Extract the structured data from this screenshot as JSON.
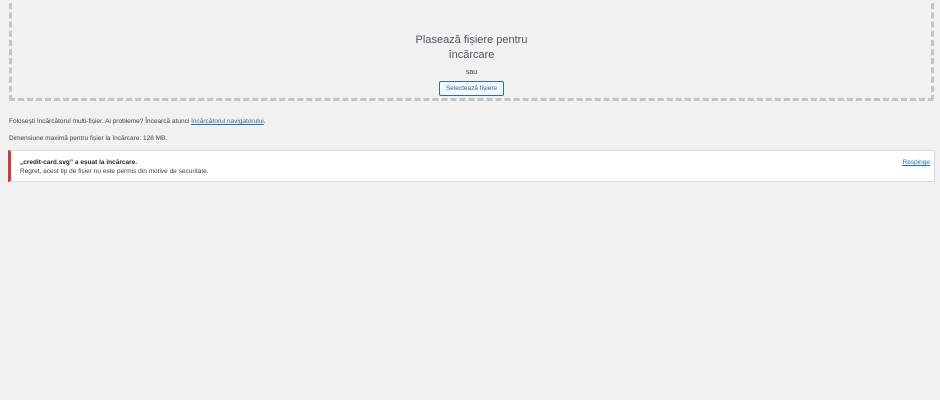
{
  "drop_zone": {
    "title": "Plasează fișiere pentru încărcare",
    "or_text": "sau",
    "select_button": "Selectează fișiere"
  },
  "uploader_info": {
    "text": "Folosești încărcătorul multi-fișier. Ai probleme? Încearcă atunci ",
    "link": "încărcătorul navigatorului",
    "suffix": "."
  },
  "max_size": "Dimensiune maximă pentru fișier la încărcare: 128 MB.",
  "error_notice": {
    "title": "„credit-card.svg” a eșuat la încărcare.",
    "message": "Regret, acest tip de fișier nu este permis din motive de securitate.",
    "dismiss": "Respinge",
    "accent_color": "#d63638"
  }
}
